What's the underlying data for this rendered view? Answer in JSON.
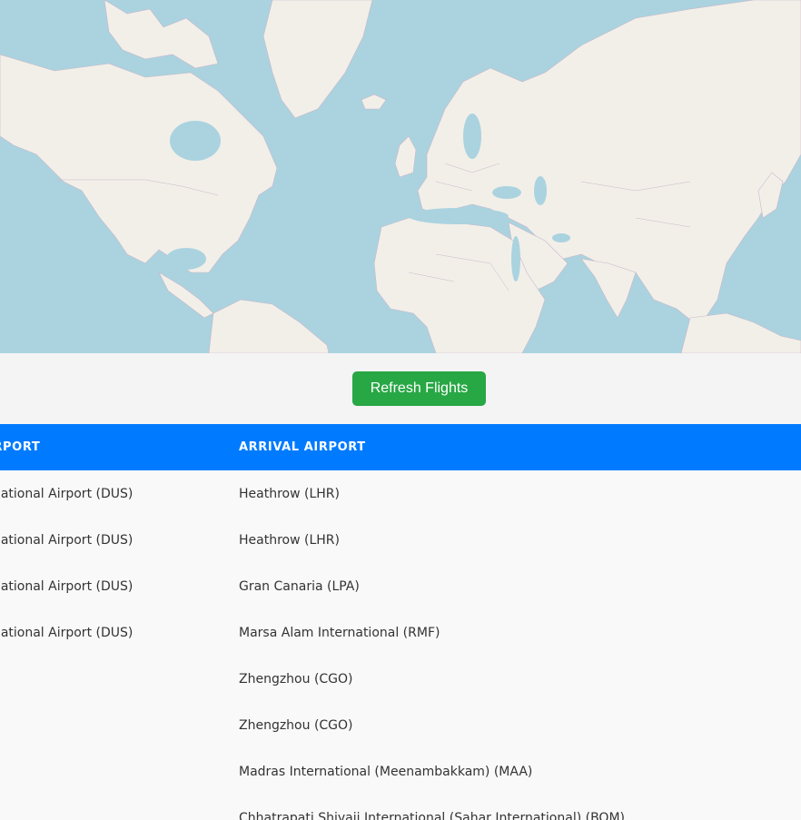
{
  "toolbar": {
    "refresh_label": "Refresh Flights"
  },
  "table": {
    "headers": {
      "departure": "DEPARTURE AIRPORT",
      "arrival": "ARRIVAL AIRPORT"
    },
    "rows": [
      {
        "departure": "Düsseldorf International Airport (DUS)",
        "arrival": "Heathrow (LHR)"
      },
      {
        "departure": "Düsseldorf International Airport (DUS)",
        "arrival": "Heathrow (LHR)"
      },
      {
        "departure": "Düsseldorf International Airport (DUS)",
        "arrival": "Gran Canaria (LPA)"
      },
      {
        "departure": "Düsseldorf International Airport (DUS)",
        "arrival": "Marsa Alam International (RMF)"
      },
      {
        "departure": "",
        "arrival": "Zhengzhou (CGO)"
      },
      {
        "departure": "",
        "arrival": "Zhengzhou (CGO)"
      },
      {
        "departure": "",
        "arrival": "Madras International (Meenambakkam) (MAA)"
      },
      {
        "departure": "",
        "arrival": "Chhatrapati Shivaji International (Sahar International) (BOM)"
      }
    ]
  },
  "colors": {
    "ocean": "#aad3df",
    "land": "#f2efe9",
    "button": "#28a745",
    "header": "#007bff"
  }
}
